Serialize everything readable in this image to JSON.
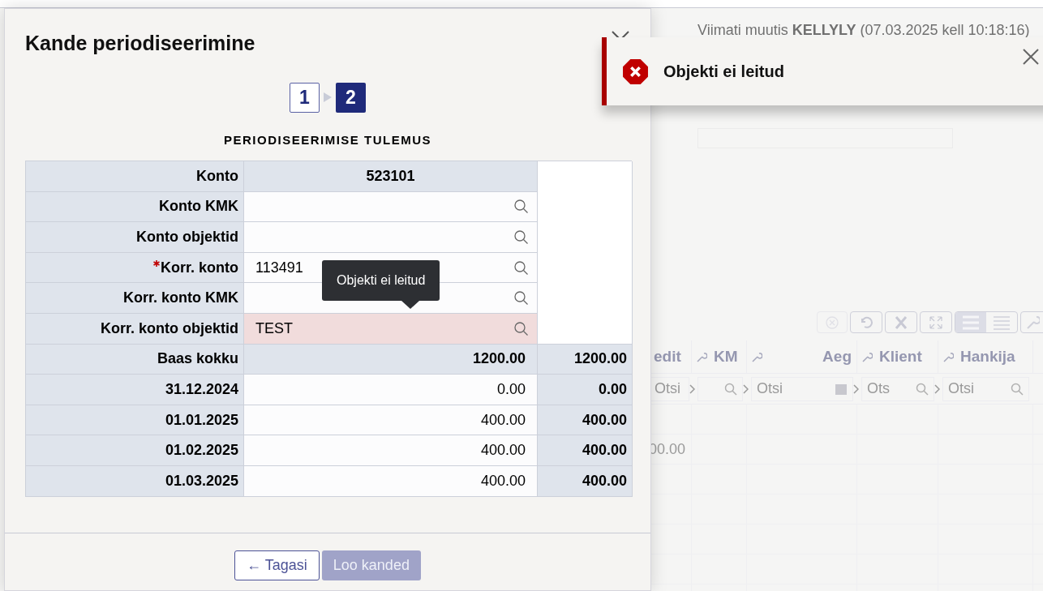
{
  "background": {
    "last_changed": "Viimati muutis **KELLYLY** (07.03.2025 kell 10:18:16)",
    "columns": [
      "edit",
      "KM",
      "Aeg",
      "Klient",
      "Hankija"
    ],
    "filters": [
      {
        "placeholder": "Otsi",
        "kind": "text"
      },
      {
        "kind": "search"
      },
      {
        "placeholder": "Otsi",
        "kind": "date"
      },
      {
        "placeholder": "Ots",
        "kind": "search"
      },
      {
        "placeholder": "Otsi",
        "kind": "search"
      }
    ],
    "cell": "00.00"
  },
  "dialog": {
    "title": "Kande periodiseerimine",
    "steps": [
      {
        "label": "1",
        "selected": false
      },
      {
        "label": "2",
        "selected": true
      }
    ],
    "section_title": "PERIODISEERIMISE TULEMUS",
    "rows": [
      {
        "kind": "header",
        "label": "Konto",
        "value": "523101"
      },
      {
        "kind": "lookup",
        "label": "Konto KMK",
        "value": "",
        "required": false,
        "error": false
      },
      {
        "kind": "lookup",
        "label": "Konto objektid",
        "value": "",
        "required": false,
        "error": false
      },
      {
        "kind": "lookup",
        "label": "Korr. konto",
        "value": "113491",
        "required": true,
        "error": false
      },
      {
        "kind": "lookup",
        "label": "Korr. konto KMK",
        "value": "",
        "required": false,
        "error": false
      },
      {
        "kind": "lookup",
        "label": "Korr. konto objektid",
        "value": "TEST",
        "required": false,
        "error": true
      },
      {
        "kind": "total",
        "label": "Baas kokku",
        "value": "1200.00",
        "total": "1200.00"
      },
      {
        "kind": "period",
        "label": "31.12.2024",
        "value": "0.00",
        "total": "0.00"
      },
      {
        "kind": "period",
        "label": "01.01.2025",
        "value": "400.00",
        "total": "400.00"
      },
      {
        "kind": "period",
        "label": "01.02.2025",
        "value": "400.00",
        "total": "400.00"
      },
      {
        "kind": "period",
        "label": "01.03.2025",
        "value": "400.00",
        "total": "400.00"
      }
    ],
    "tooltip": "Objekti ei leitud",
    "buttons": [
      {
        "label": "← Tagasi",
        "disabled": false
      },
      {
        "label": "Loo kanded",
        "disabled": true
      }
    ]
  },
  "toast": {
    "message": "Objekti ei leitud"
  }
}
